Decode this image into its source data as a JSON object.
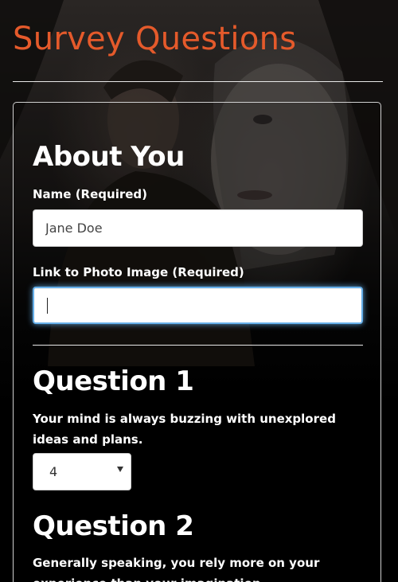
{
  "page": {
    "title": "Survey Questions"
  },
  "about": {
    "heading": "About You",
    "name_label": "Name (Required)",
    "name_value": "Jane Doe",
    "photo_label": "Link to Photo Image (Required)",
    "photo_value": ""
  },
  "questions": [
    {
      "heading": "Question 1",
      "text": "Your mind is always buzzing with unexplored ideas and plans.",
      "selected": "4"
    },
    {
      "heading": "Question 2",
      "text": "Generally speaking, you rely more on your experience than your imagination."
    }
  ],
  "colors": {
    "title": "#e55a2b",
    "focus_glow": "#66afe9"
  }
}
